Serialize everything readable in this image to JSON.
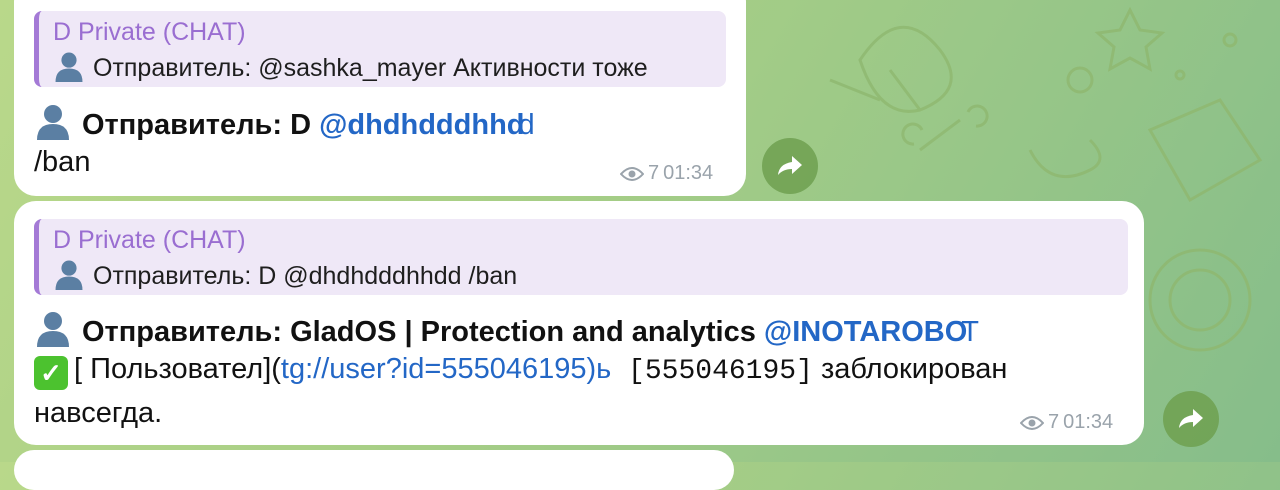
{
  "messages": [
    {
      "quote_title": "D Private (CHAT)",
      "quote_text": "Отправитель:  @sashka_mayer Активности тоже",
      "sender_prefix": "Отправитель: D",
      "sender_handle": "@dhdhdddhhd",
      "sender_handle_tail": "d",
      "body": "/ban",
      "views": "7",
      "time": "01:34"
    },
    {
      "quote_title": "D Private (CHAT)",
      "quote_text": "Отправитель: D @dhdhdddhhdd /ban",
      "sender_prefix": "Отправитель: GladOS | Protection and analytics",
      "sender_handle": "@INOTAROBO",
      "sender_handle_tail": "T",
      "body_bracket": "[ Пользовател](",
      "body_link": "tg://user?id=555046195)ь",
      "body_mono": " [555046195]",
      "body_rest": " заблокирован",
      "body_line2": "навсегда.",
      "views": "7",
      "time": "01:34"
    }
  ],
  "icons": {
    "person": "bust-silhouette-icon",
    "check": "check-mark-button-icon",
    "eye": "eye-icon",
    "forward": "forward-arrow-icon"
  },
  "colors": {
    "quote_accent": "#9a6ed1",
    "link": "#2367c6",
    "forward_button": "#6ea050"
  }
}
